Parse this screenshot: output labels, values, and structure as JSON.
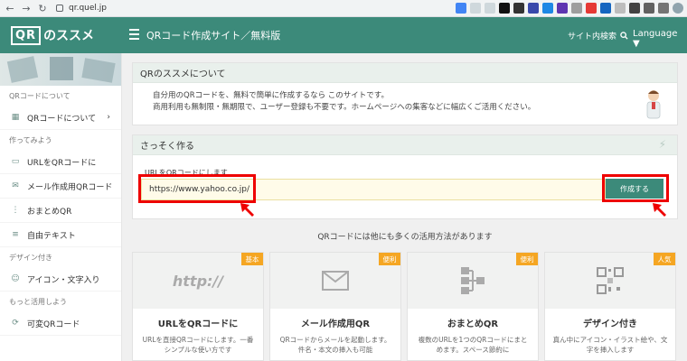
{
  "browser": {
    "url": "qr.quel.jp"
  },
  "header": {
    "logo_qr": "QR",
    "logo_rest": "のススメ",
    "title": "QRコード作成サイト／無料版",
    "search_label": "サイト内検索",
    "language": "Language ▼"
  },
  "sidebar": {
    "section1": "QRコードについて",
    "item_about": "QRコードについて",
    "section2": "作ってみよう",
    "item_url": "URLをQRコードに",
    "item_mail": "メール作成用QRコード",
    "item_bundle": "おまとめQR",
    "item_text": "自由テキスト",
    "section3": "デザイン付き",
    "item_icon": "アイコン・文字入り",
    "section4": "もっと活用しよう",
    "item_variable": "可変QRコード"
  },
  "about": {
    "title": "QRのススメについて",
    "line1": "自分用のQRコードを、無料で簡単に作成するなら このサイトです。",
    "line2": "商用利用も無制限・無期限で、ユーザー登録も不要です。ホームページへの集客などに幅広くご活用ください。"
  },
  "create": {
    "title": "さっそく作る",
    "url_label": "URLをQRコードにします",
    "url_value": "https://www.yahoo.co.jp/",
    "button": "作成する"
  },
  "uses": {
    "title": "QRコードには他にも多くの活用方法があります",
    "cards": [
      {
        "badge": "基本",
        "img_text": "http://",
        "title": "URLをQRコードに",
        "desc": "URLを直接QRコードにします。一番シンプルな使い方です"
      },
      {
        "badge": "便利",
        "title": "メール作成用QR",
        "desc": "QRコードからメールを起動します。件名・本文の挿入も可能"
      },
      {
        "badge": "便利",
        "title": "おまとめQR",
        "desc": "複数のURLを1つのQRコードにまとめます。スペース節約に"
      },
      {
        "badge": "人気",
        "title": "デザイン付き",
        "desc": "真ん中にアイコン・イラスト絵や、文字を挿入します"
      }
    ]
  },
  "colors": {
    "brand": "#3c8a7a",
    "highlight": "#e00000",
    "badge": "#f5a623"
  }
}
